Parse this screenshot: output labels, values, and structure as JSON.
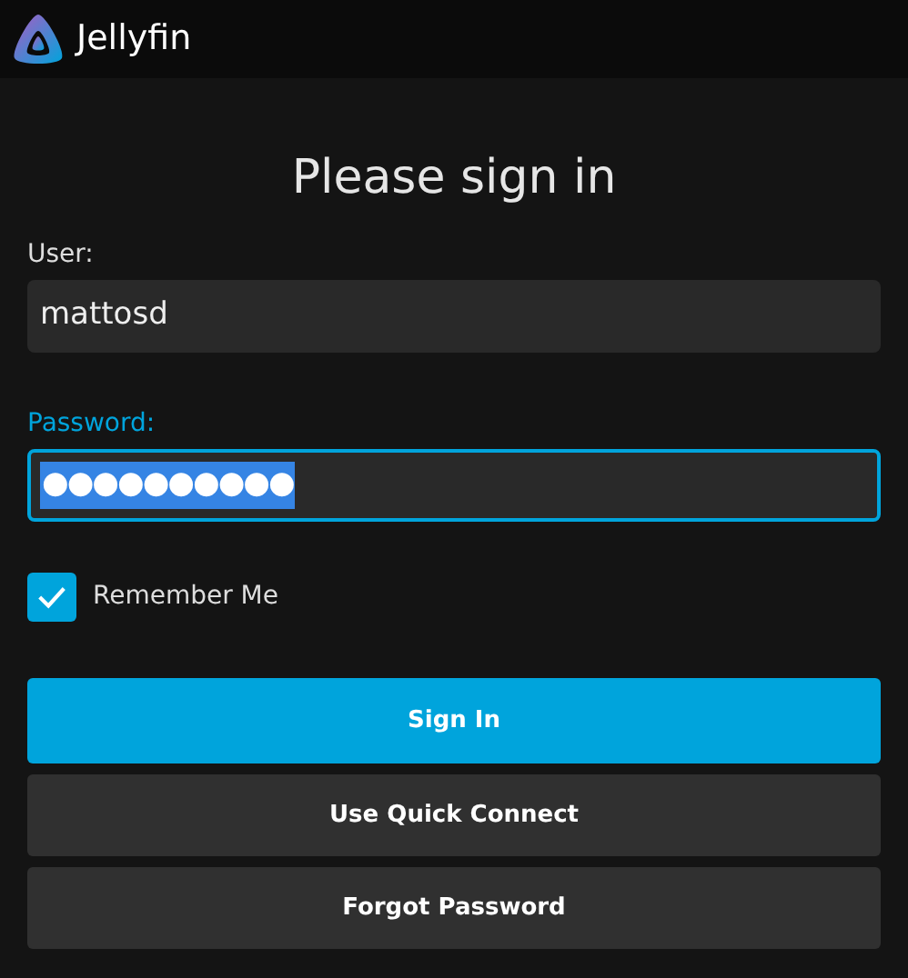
{
  "header": {
    "app_name": "Jellyfin"
  },
  "title": "Please sign in",
  "fields": [
    {
      "kind": "text",
      "label": "User:",
      "value": "mattosd",
      "focused": false,
      "value_selected": false
    },
    {
      "kind": "password",
      "label": "Password:",
      "value": "●●●●●●●●●●",
      "focused": true,
      "value_selected": true
    }
  ],
  "remember_me": {
    "label": "Remember Me",
    "checked": true
  },
  "buttons": [
    {
      "kind": "primary",
      "label": "Sign In"
    },
    {
      "kind": "secondary",
      "label": "Use Quick Connect"
    },
    {
      "kind": "secondary",
      "label": "Forgot Password"
    }
  ]
}
